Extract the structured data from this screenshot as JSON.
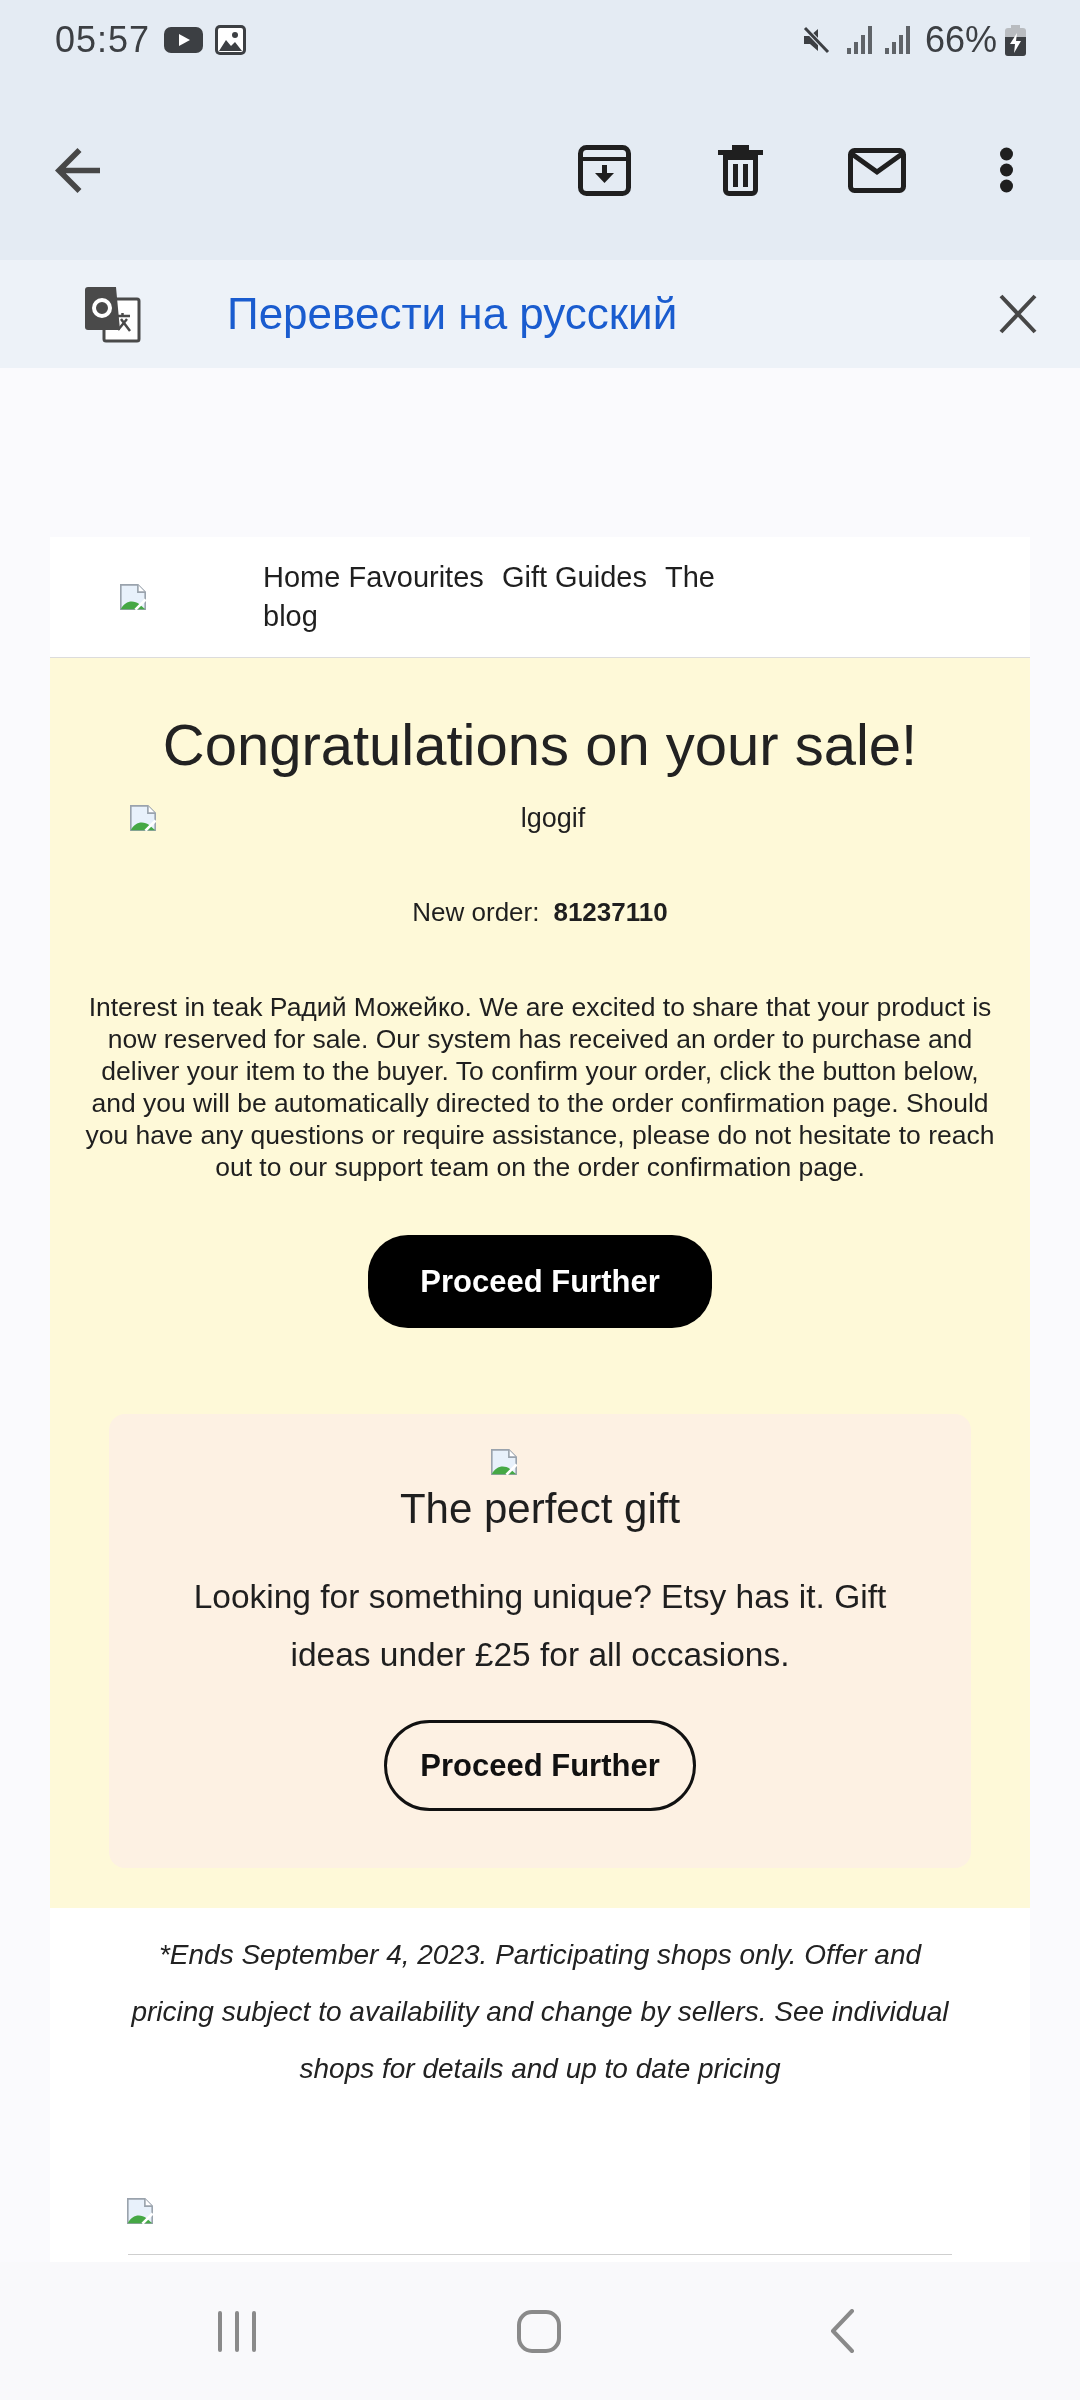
{
  "status_bar": {
    "time": "05:57",
    "battery": "66%"
  },
  "translate_bar": {
    "label": "Перевести на русский"
  },
  "email": {
    "nav_links": [
      "Home",
      "Favourites",
      "Gift Guides",
      "The blog"
    ],
    "heading": "Congratulations on your sale!",
    "image_alt": "lgogif",
    "order": {
      "label": "New order:",
      "number": "81237110"
    },
    "message": "Interest in teak Радий Можейко. We are excited to share that your product is now reserved for sale. Our system has received an order to purchase and deliver your item to the buyer. To confirm your order, click the button below, and you will be automatically directed to the order confirmation page. Should you have any questions or require assistance, please do not hesitate to reach out to our support team on the order confirmation page.",
    "button": "Proceed Further",
    "promo": {
      "title": "The perfect gift",
      "text": "Looking for something unique? Etsy has it. Gift ideas under £25 for all occasions.",
      "button": "Proceed Further"
    },
    "disclaimer": "*Ends September 4, 2023. Participating shops only. Offer and pricing subject to availability and change by sellers. See individual shops for details and up to date pricing"
  }
}
